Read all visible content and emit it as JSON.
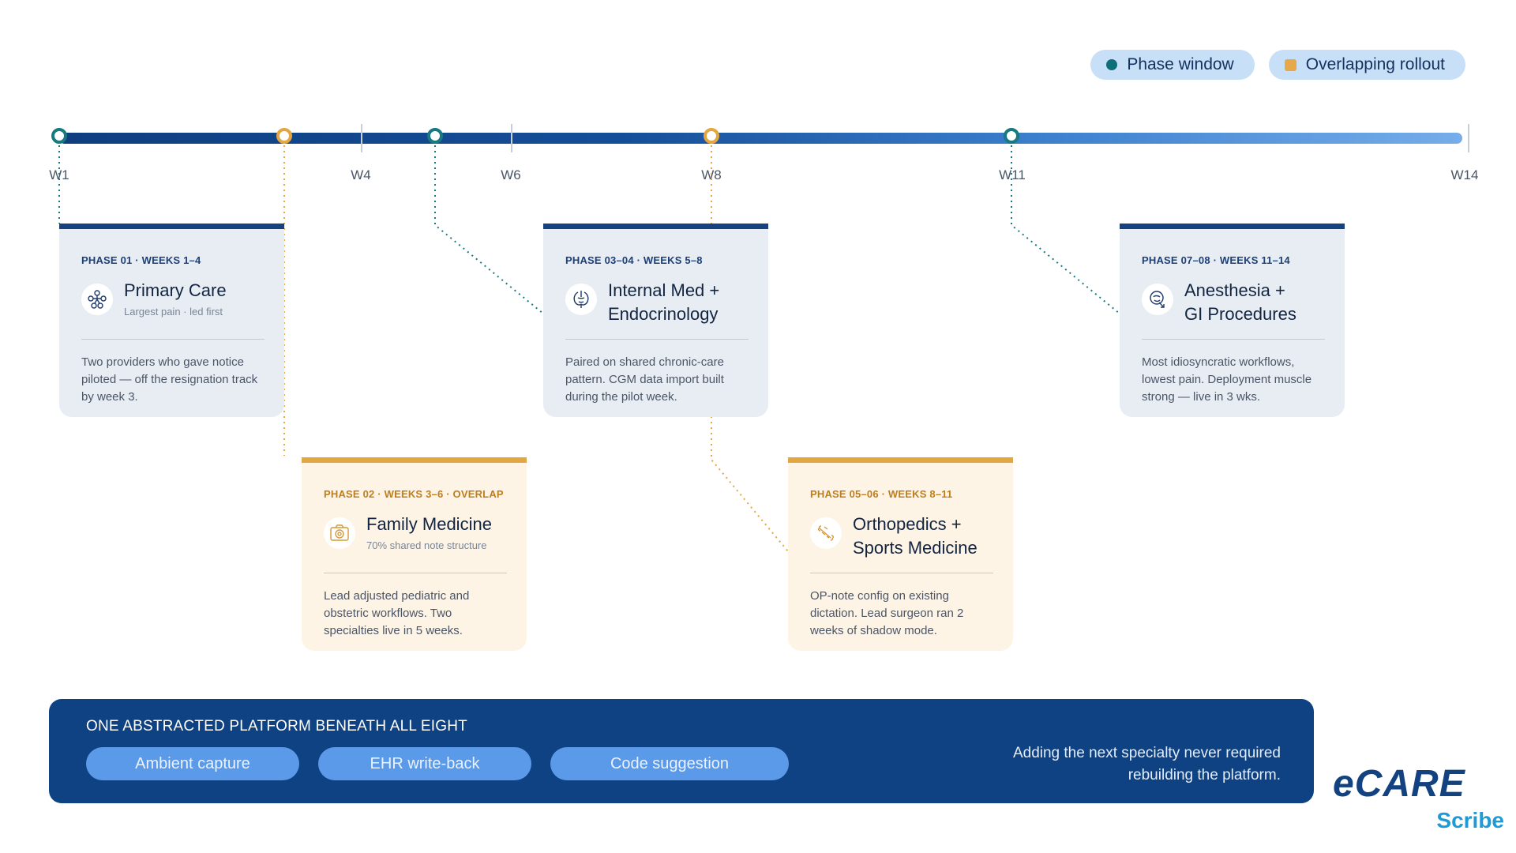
{
  "legend": {
    "phase_window": "Phase window",
    "overlapping_rollout": "Overlapping rollout"
  },
  "colors": {
    "phase_window": "#0f6f78",
    "overlapping": "#e2a740",
    "navy": "#16427f",
    "platform_bg": "#0f4283"
  },
  "timeline": {
    "labels": [
      "W1",
      "W4",
      "W6",
      "W8",
      "W11",
      "W14"
    ]
  },
  "cards": [
    {
      "phase": "PHASE 01 · WEEKS 1–4",
      "title_line1": "Primary Care",
      "title_line2": "",
      "subtitle": "Largest pain · led first",
      "body": "Two providers who gave notice piloted — off the resignation track by week 3.",
      "icon": "care-team-icon",
      "style": "phase-window"
    },
    {
      "phase": "PHASE 02 · WEEKS 3–6 · OVERLAP",
      "title_line1": "Family Medicine",
      "title_line2": "",
      "subtitle": "70% shared note structure",
      "body": "Lead adjusted pediatric and obstetric workflows. Two specialties live in 5 weeks.",
      "icon": "family-photo-icon",
      "style": "overlapping"
    },
    {
      "phase": "PHASE 03–04 · WEEKS 5–8",
      "title_line1": "Internal Med +",
      "title_line2": "Endocrinology",
      "subtitle": "",
      "body": "Paired on shared chronic-care pattern. CGM data import built during the pilot week.",
      "icon": "organs-icon",
      "style": "phase-window"
    },
    {
      "phase": "PHASE 05–06 · WEEKS 8–11",
      "title_line1": "Orthopedics +",
      "title_line2": "Sports Medicine",
      "subtitle": "",
      "body": "OP-note config on existing dictation. Lead surgeon ran 2 weeks of shadow mode.",
      "icon": "bone-icon",
      "style": "overlapping"
    },
    {
      "phase": "PHASE 07–08 · WEEKS 11–14",
      "title_line1": "Anesthesia +",
      "title_line2": "GI Procedures",
      "subtitle": "",
      "body": "Most idiosyncratic workflows, lowest pain. Deployment muscle strong — live in 3 wks.",
      "icon": "anesthesia-mask-icon",
      "style": "phase-window"
    }
  ],
  "platform": {
    "title": "ONE ABSTRACTED PLATFORM BENEATH ALL EIGHT",
    "chips": [
      "Ambient capture",
      "EHR write-back",
      "Code suggestion"
    ],
    "note": "Adding the next specialty never required rebuilding the platform."
  },
  "logo": {
    "main": "eCARE",
    "sub": "Scribe"
  }
}
